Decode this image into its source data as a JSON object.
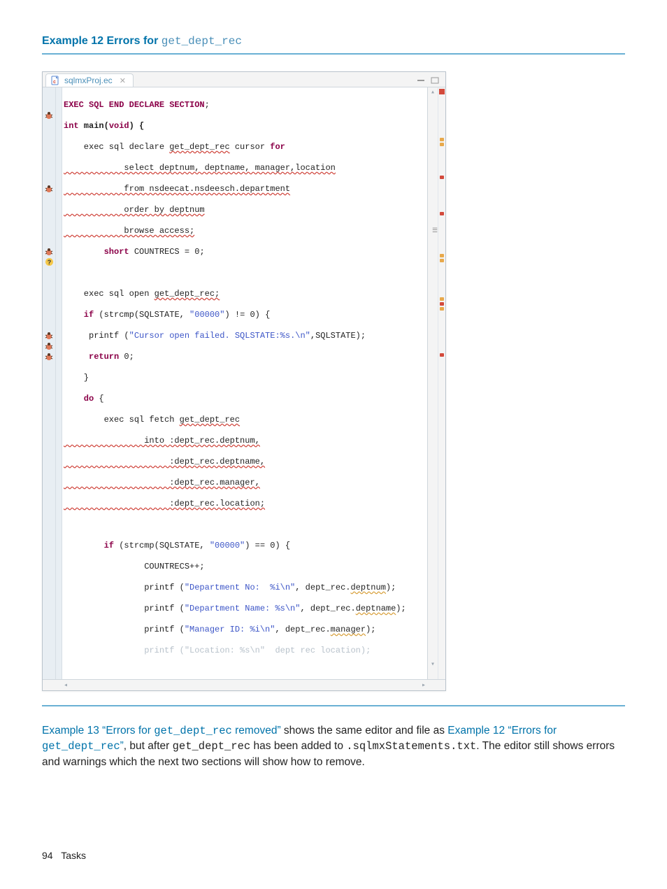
{
  "heading": {
    "prefix": "Example 12 Errors for ",
    "code": "get_dept_rec"
  },
  "editor": {
    "tab": {
      "label": "sqlmxProj.ec"
    },
    "code": {
      "l1": {
        "kw": "EXEC SQL END DECLARE SECTION",
        "semi": ";"
      },
      "l2": {
        "kw": "int",
        "rest": " main(",
        "kw2": "void",
        "rest2": ") {"
      },
      "l3": {
        "text": "    exec sql declare ",
        "err": "get_dept_rec",
        "text2": " cursor ",
        "kw": "for"
      },
      "l4": {
        "err": "            select deptnum, deptname, manager,location"
      },
      "l5": {
        "err": "            from nsdeecat.nsdeesch.department"
      },
      "l6": {
        "err": "            order by deptnum"
      },
      "l7": {
        "err": "            browse access;"
      },
      "l8": {
        "kw": "        short",
        "text": " COUNTRECS = 0;"
      },
      "l9": "",
      "l10": {
        "text": "    exec sql open ",
        "err": "get_dept_rec;"
      },
      "l11": {
        "kw": "    if",
        "text": " (strcmp(SQLSTATE, ",
        "str": "\"00000\"",
        "text2": ") != 0) {"
      },
      "l12": {
        "text": "     printf (",
        "str": "\"Cursor open failed. SQLSTATE:%s.\\n\"",
        "text2": ",SQLSTATE);"
      },
      "l13": {
        "kw": "     return",
        "text": " 0;"
      },
      "l14": {
        "text": "    }"
      },
      "l15": {
        "kw": "    do",
        "text": " {"
      },
      "l16": {
        "text": "        exec sql fetch ",
        "err": "get_dept_rec"
      },
      "l17": {
        "err": "                into :dept_rec.deptnum,"
      },
      "l18": {
        "err": "                     :dept_rec.deptname,"
      },
      "l19": {
        "err": "                     :dept_rec.manager,"
      },
      "l20": {
        "err": "                     :dept_rec.location;"
      },
      "l21": "",
      "l22": {
        "kw": "        if",
        "text": " (strcmp(SQLSTATE, ",
        "str": "\"00000\"",
        "text2": ") == 0) {"
      },
      "l23": {
        "text": "                COUNTRECS++;"
      },
      "l24": {
        "text": "                printf (",
        "str": "\"Department No:  %i\\n\"",
        "text2": ", dept_rec.",
        "warn": "deptnum",
        "text3": ");"
      },
      "l25": {
        "text": "                printf (",
        "str": "\"Department Name: %s\\n\"",
        "text2": ", dept_rec.",
        "warn": "deptname",
        "text3": ");"
      },
      "l26": {
        "text": "                printf (",
        "str": "\"Manager ID: %i\\n\"",
        "text2": ", dept_rec.",
        "warn": "manager",
        "text3": ");"
      },
      "l27": {
        "faded": "                printf (\"Location: %s\\n\"  dept rec location);"
      }
    }
  },
  "paragraph": {
    "link1_a": "Example 13 “Errors for ",
    "link1_code": "get_dept_rec",
    "link1_b": " removed”",
    "text1": " shows the same editor and file as ",
    "link2_a": "Example 12 “Errors for ",
    "link2_code": "get_dept_rec",
    "link2_b": "”",
    "text2": ", but after ",
    "code1": "get_dept_rec",
    "text3": " has been added to ",
    "code2": ".sqlmxStatements.txt",
    "text4": ". The editor still shows errors and warnings which the next two sections will show how to remove."
  },
  "footer": {
    "page": "94",
    "section": "Tasks"
  }
}
